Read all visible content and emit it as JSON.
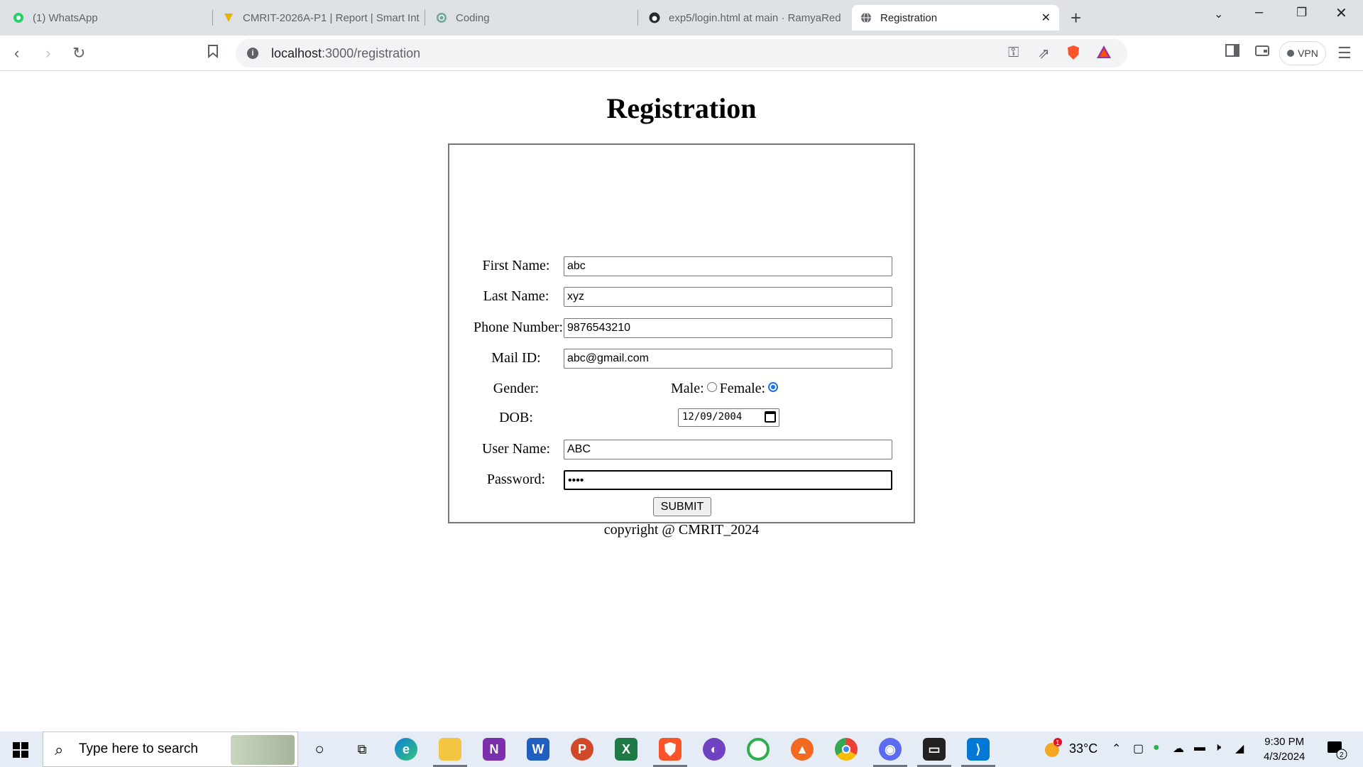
{
  "browser": {
    "tabs": [
      {
        "title": "(1) WhatsApp",
        "icon": "whatsapp-icon"
      },
      {
        "title": "CMRIT-2026A-P1 | Report | Smart Int",
        "icon": "smartinterviews-icon"
      },
      {
        "title": "Coding",
        "icon": "chatgpt-icon"
      },
      {
        "title": "exp5/login.html at main · RamyaRed",
        "icon": "github-icon"
      },
      {
        "title": "Registration",
        "icon": "globe-icon",
        "active": true
      }
    ],
    "url_host": "localhost",
    "url_path": ":3000/registration",
    "vpn_label": "VPN"
  },
  "page": {
    "title": "Registration",
    "form": {
      "first_name_label": "First Name:",
      "first_name_value": "abc",
      "last_name_label": "Last Name:",
      "last_name_value": "xyz",
      "phone_label": "Phone Number:",
      "phone_value": "9876543210",
      "mail_label": "Mail ID:",
      "mail_value": "abc@gmail.com",
      "gender_label": "Gender:",
      "male_label": "Male:",
      "female_label": "Female:",
      "gender_selected": "Female",
      "dob_label": "DOB:",
      "dob_value": "12/09/2004",
      "username_label": "User Name:",
      "username_value": "ABC",
      "password_label": "Password:",
      "password_value": "••••",
      "submit_label": "SUBMIT"
    },
    "footer": "copyright @ CMRIT_2024"
  },
  "taskbar": {
    "search_placeholder": "Type here to search",
    "temperature": "33°C",
    "time": "9:30 PM",
    "date": "4/3/2024",
    "notification_count": "2",
    "weather_badge": "1"
  }
}
